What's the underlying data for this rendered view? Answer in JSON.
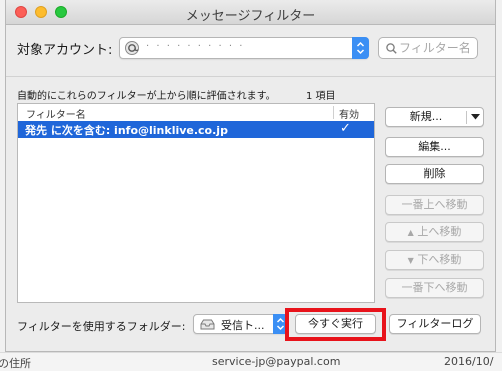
{
  "window": {
    "title": "メッセージフィルター"
  },
  "account": {
    "label": "対象アカウント:",
    "value": "· · · · · · · · · ·"
  },
  "search": {
    "placeholder": "フィルター名"
  },
  "description": "自動的にこれらのフィルターが上から順に評価されます。",
  "count": "1 項目",
  "table": {
    "columns": {
      "name": "フィルター名",
      "enabled": "有効"
    },
    "rows": [
      {
        "name": "発先 に次を含む: info@linklive.co.jp",
        "enabled": "✓"
      }
    ]
  },
  "buttons": {
    "new": "新規...",
    "edit": "編集...",
    "delete": "削除",
    "move_top": "一番上へ移動",
    "move_up": "上へ移動",
    "move_down": "下へ移動",
    "move_bottom": "一番下へ移動",
    "run_now": "今すぐ実行",
    "filter_log": "フィルターログ"
  },
  "footer": {
    "label": "フィルターを使用するフォルダー:",
    "folder": "受信ト..."
  },
  "background": {
    "sender": "service-jp@paypal.com",
    "date": "2016/10/",
    "left_fragment": "の住所"
  },
  "colors": {
    "selection": "#1f66d9",
    "accent": "#3b8ff4",
    "highlight": "#e8131b"
  }
}
